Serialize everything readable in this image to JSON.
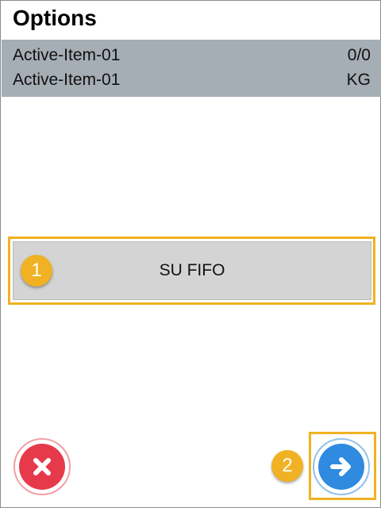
{
  "header": {
    "title": "Options"
  },
  "item_info": [
    {
      "name": "Active-Item-01",
      "value": "0/0"
    },
    {
      "name": "Active-Item-01",
      "value": "KG"
    }
  ],
  "options": {
    "su_fifo_label": "SU FIFO"
  },
  "callouts": {
    "first": "1",
    "second": "2"
  },
  "actions": {
    "cancel_icon": "close-icon",
    "next_icon": "arrow-right-icon"
  },
  "colors": {
    "info_bar": "#a5adb5",
    "highlight": "#f0b222",
    "cancel": "#e63a4b",
    "next": "#2f8ae0"
  }
}
